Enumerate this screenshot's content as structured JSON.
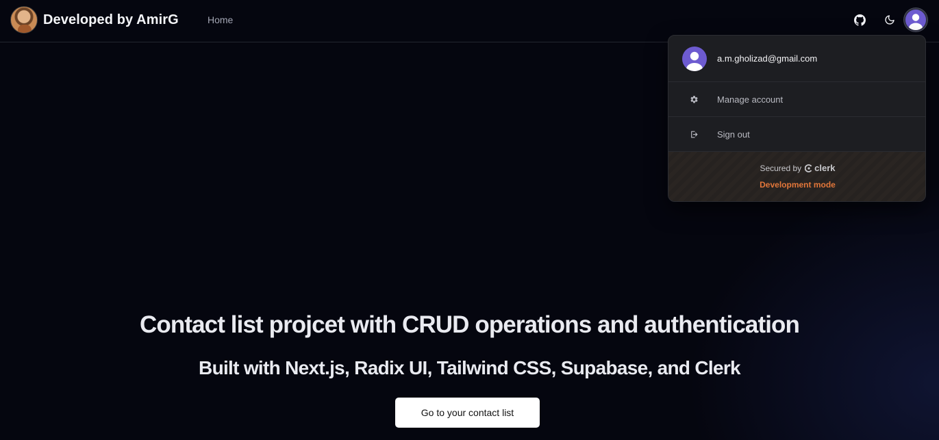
{
  "navbar": {
    "brand_title": "Developed by AmirG",
    "brand_avatar_icon": "developer-avatar",
    "links": [
      {
        "label": "Home"
      }
    ],
    "github_icon": "github-icon",
    "theme_icon": "moon-icon",
    "user_icon": "user-avatar-icon"
  },
  "user_menu": {
    "email": "a.m.gholizad@gmail.com",
    "items": [
      {
        "label": "Manage account",
        "icon": "gear-icon"
      },
      {
        "label": "Sign out",
        "icon": "sign-out-icon"
      }
    ],
    "secured_by": "Secured by",
    "provider": "clerk",
    "mode": "Development mode"
  },
  "hero": {
    "title": "Contact list projcet with CRUD operations and authentication",
    "subtitle": "Built with Next.js, Radix UI, Tailwind CSS, Supabase, and Clerk",
    "cta_label": "Go to your contact list"
  },
  "colors": {
    "background": "#05060f",
    "avatar_accent": "#6d5bd0",
    "dev_mode": "#e3773a"
  }
}
